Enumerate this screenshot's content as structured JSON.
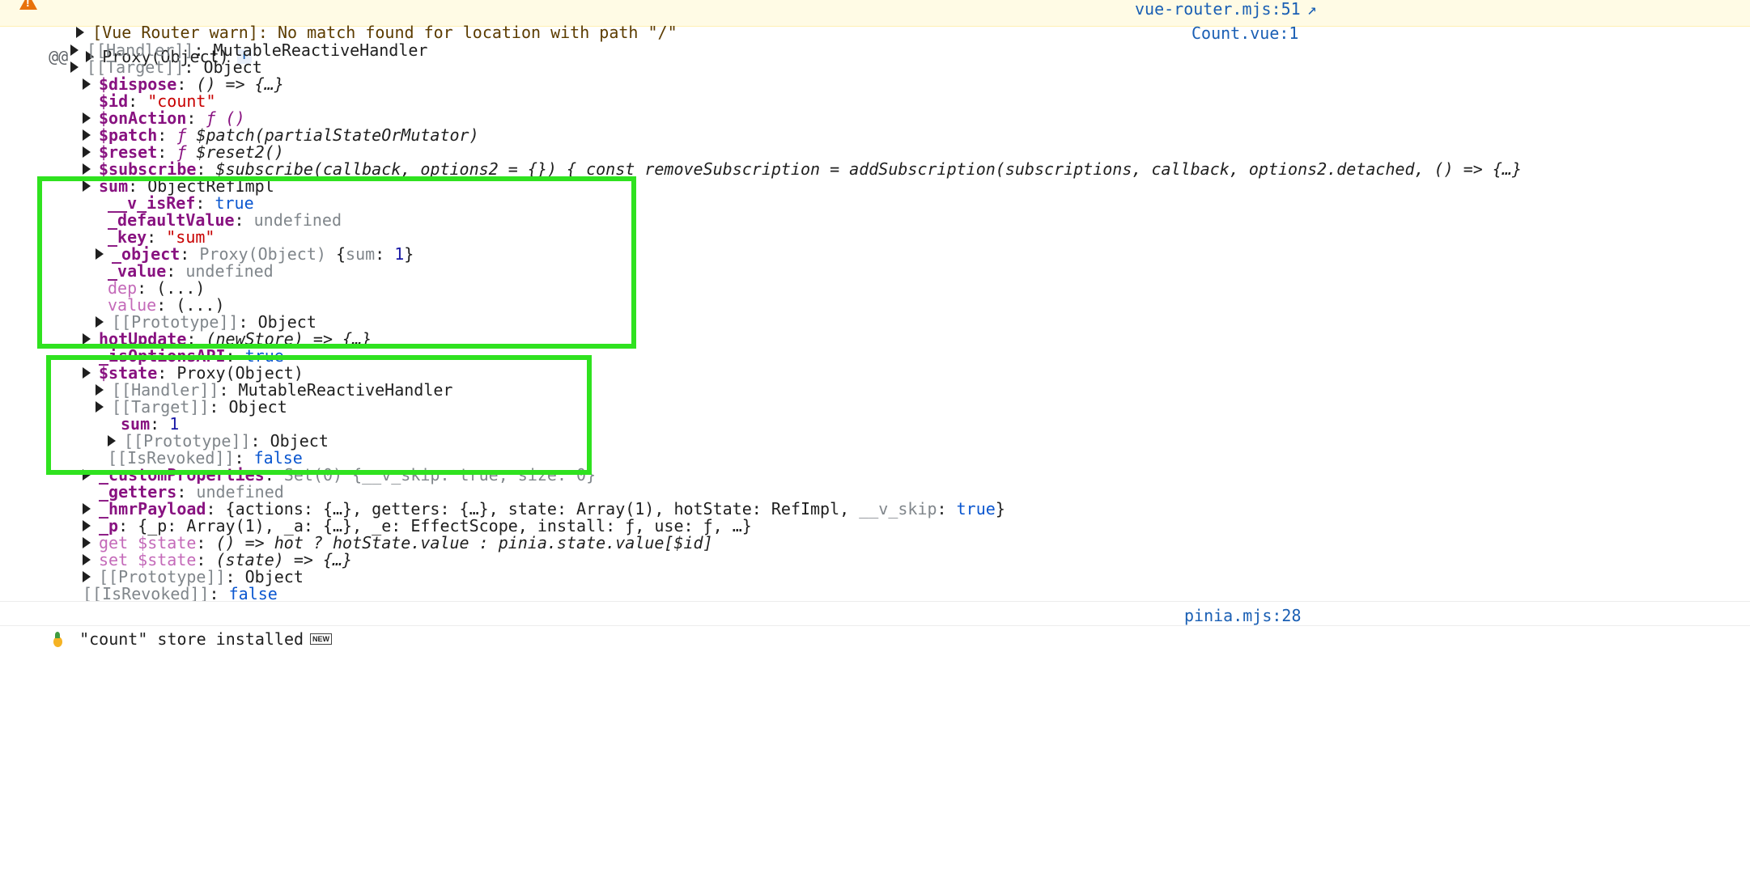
{
  "warning": {
    "message": "[Vue Router warn]: No match found for location with path \"/\"",
    "source": "vue-router.mjs:51",
    "source_extra": "↗"
  },
  "log": {
    "prefix": "@@",
    "root_label": "Proxy(Object)",
    "info_badge": "i",
    "source": "Count.vue:1",
    "handler_key": "[[Handler]]",
    "handler_val": "MutableReactiveHandler",
    "target_key": "[[Target]]",
    "target_val": "Object",
    "dispose_key": "$dispose",
    "dispose_val": "() => {…}",
    "id_key": "$id",
    "id_val": "\"count\"",
    "onaction_key": "$onAction",
    "onaction_val": "ƒ ()",
    "patch_key": "$patch",
    "patch_f": "ƒ",
    "patch_val": "$patch(partialStateOrMutator)",
    "reset_key": "$reset",
    "reset_f": "ƒ",
    "reset_val": "$reset2()",
    "subscribe_key": "$subscribe",
    "subscribe_val": "$subscribe(callback, options2 = {}) { const removeSubscription = addSubscription(subscriptions, callback, options2.detached, () => {…}",
    "sum_key": "sum",
    "sum_val": "ObjectRefImpl",
    "isref_key": "__v_isRef",
    "isref_val": "true",
    "defval_key": "_defaultValue",
    "defval_val": "undefined",
    "key_key": "_key",
    "key_val": "\"sum\"",
    "object_key": "_object",
    "object_val1": "Proxy(Object)",
    "object_val2": " {",
    "object_val3": "sum",
    "object_val4": ": ",
    "object_val5": "1",
    "object_val6": "}",
    "value_key": "_value",
    "value_val": "undefined",
    "dep_key": "dep",
    "dep_val": "(...)",
    "value2_key": "value",
    "value2_val": "(...)",
    "proto_key": "[[Prototype]]",
    "proto_val": "Object",
    "hotupdate_key": "hotUpdate",
    "hotupdate_val": "(newStore) => {…}",
    "isoptions_key": "_isOptionsAPI",
    "isoptions_val": "true",
    "state_key": "$state",
    "state_val": "Proxy(Object)",
    "st_handler_key": "[[Handler]]",
    "st_handler_val": "MutableReactiveHandler",
    "st_target_key": "[[Target]]",
    "st_target_val": "Object",
    "st_sum_key": "sum",
    "st_sum_val": "1",
    "st_proto_key": "[[Prototype]]",
    "st_proto_val": "Object",
    "st_revoked_key": "[[IsRevoked]]",
    "st_revoked_val": "false",
    "custom_key": "_customProperties",
    "custom_val": "Set(0) {__v_skip: true, size: 0}",
    "getters_key": "_getters",
    "getters_val": "undefined",
    "hmr_key": "_hmrPayload",
    "hmr_v1": "{actions: {…}, getters: {…}, state: Array(1), ",
    "hmr_k2": "hotState",
    "hmr_v2": ": RefImpl, ",
    "hmr_k3": "__v_skip",
    "hmr_v3": ": ",
    "hmr_v4": "true",
    "hmr_v5": "}",
    "p_key": "_p",
    "p_v1": "{_p: Array(1), _a: {…}, _e: EffectScope, install: ƒ, use: ƒ, …}",
    "getstate_key": "get $state",
    "getstate_val": "() => hot ? hotState.value : pinia.state.value[$id]",
    "setstate_key": "set $state",
    "setstate_val": "(state) => {…}",
    "root_proto_key": "[[Prototype]]",
    "root_proto_val": "Object",
    "root_revoked_key": "[[IsRevoked]]",
    "root_revoked_val": "false"
  },
  "pinia": {
    "message": "\"count\" store installed",
    "badge": "NEW",
    "source": "pinia.mjs:28"
  },
  "colors": {
    "highlight": "#2fe21f",
    "warning_bg": "#fffbe5",
    "link": "#1a5fb4"
  }
}
